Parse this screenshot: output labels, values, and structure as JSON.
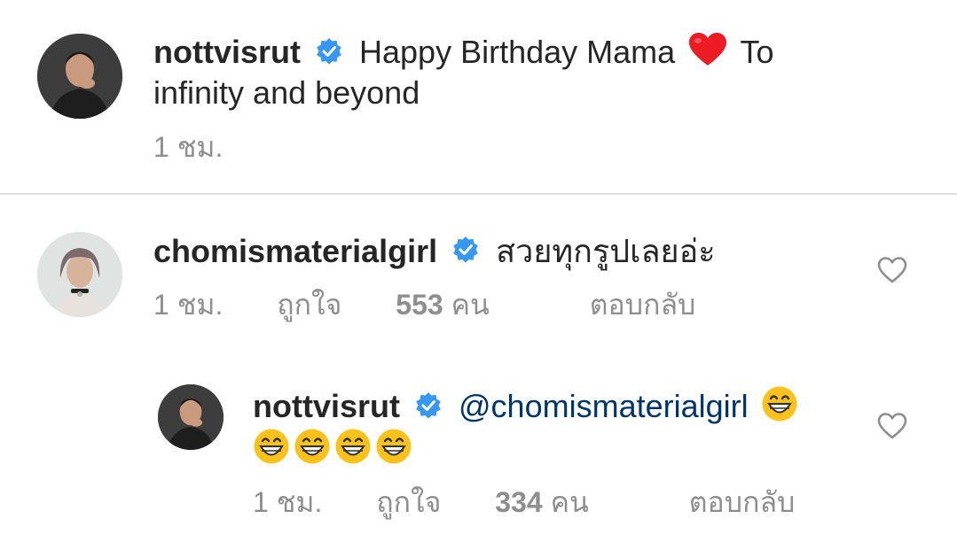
{
  "caption": {
    "username": "nottvisrut",
    "text_part1": "Happy Birthday Mama",
    "text_part2": "To",
    "text_line2": "infinity and beyond",
    "time": "1 ชม."
  },
  "comment": {
    "username": "chomismaterialgirl",
    "text": "สวยทุกรูปเลยอ่ะ",
    "time": "1 ชม.",
    "likes_prefix": "ถูกใจ",
    "likes_count": "553",
    "likes_suffix": "คน",
    "reply_label": "ตอบกลับ"
  },
  "reply": {
    "username": "nottvisrut",
    "mention": "@chomismaterialgirl",
    "time": "1 ชม.",
    "likes_prefix": "ถูกใจ",
    "likes_count": "334",
    "likes_suffix": "คน",
    "reply_label": "ตอบกลับ"
  },
  "colors": {
    "verified": "#3897f0",
    "heart": "#ed1c24",
    "mention": "#003569",
    "meta": "#8e8e8e"
  }
}
